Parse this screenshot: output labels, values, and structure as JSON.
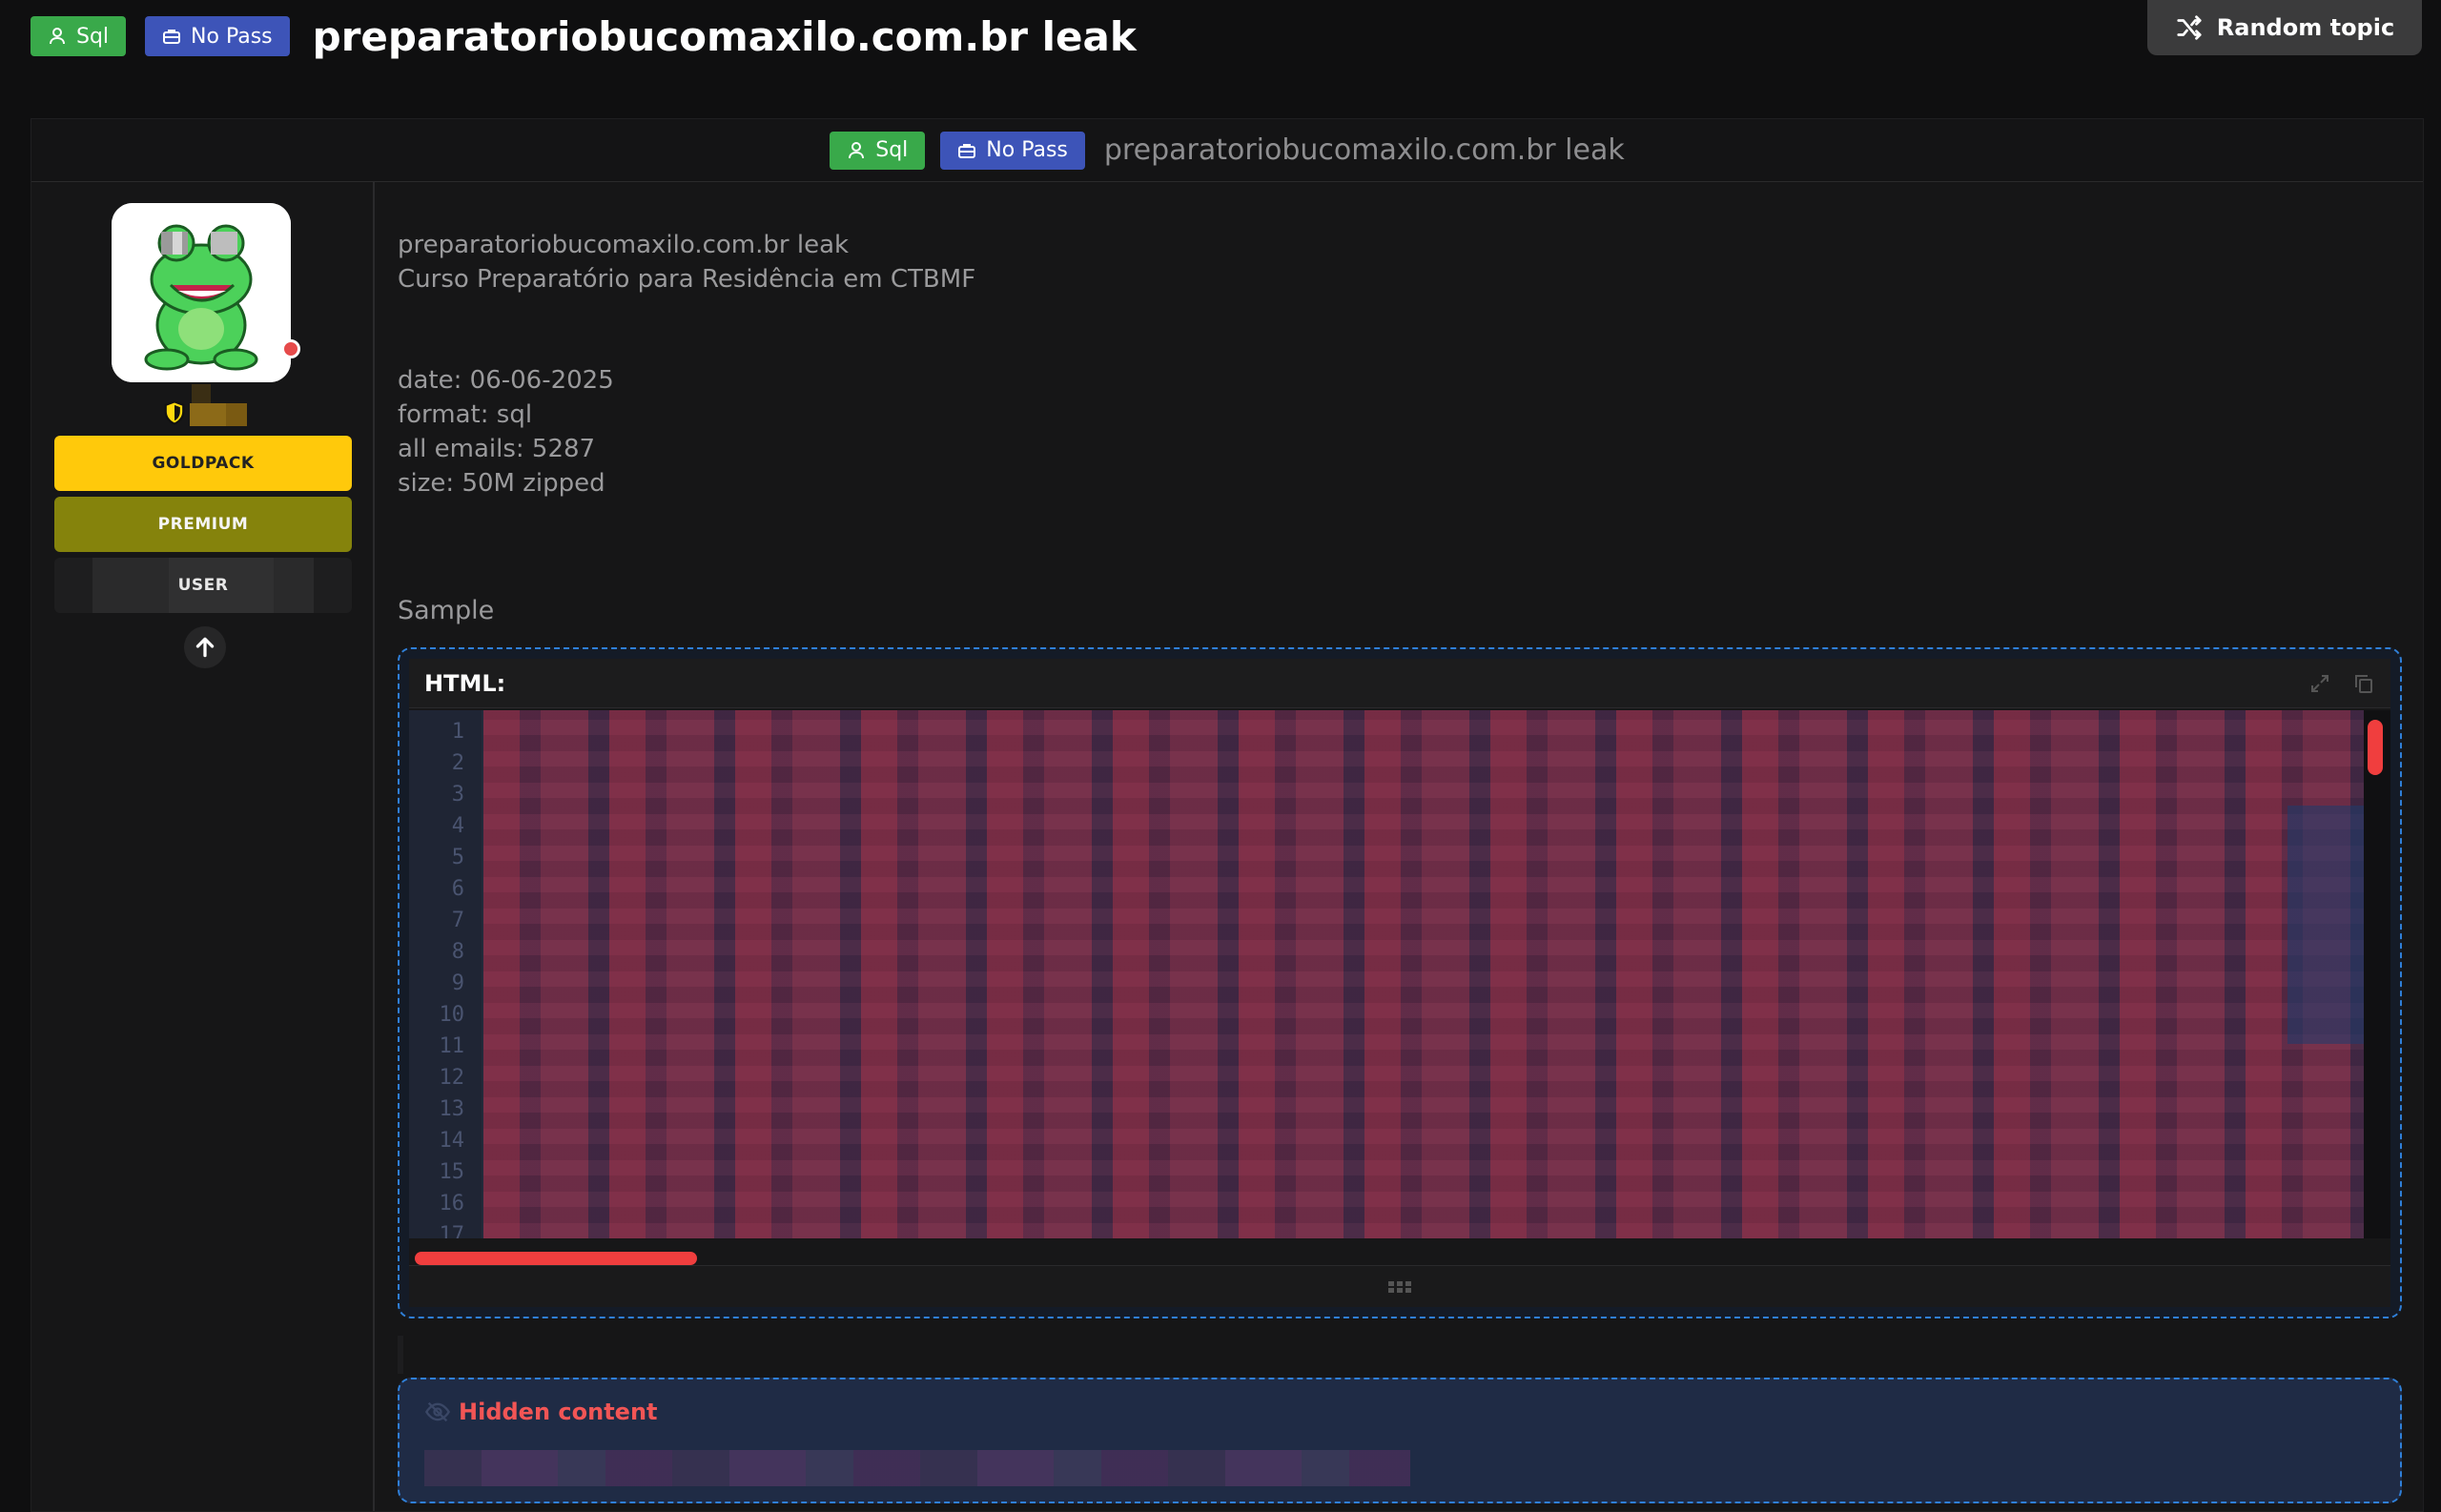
{
  "header": {
    "badge_sql": "Sql",
    "badge_nopass": "No Pass",
    "title": "preparatoriobucomaxilo.com.br leak",
    "random_button": "Random topic"
  },
  "thread": {
    "badge_sql": "Sql",
    "badge_nopass": "No Pass",
    "title": "preparatoriobucomaxilo.com.br leak"
  },
  "author": {
    "roles": [
      "GOLDPACK",
      "PREMIUM",
      "USER"
    ],
    "colors": {
      "goldpack": "#ffc90b",
      "premium": "#85830c",
      "online": "#e64b4b"
    }
  },
  "post": {
    "intro": [
      "preparatoriobucomaxilo.com.br leak",
      "Curso Preparatório para Residência em CTBMF"
    ],
    "details": [
      "date: 06-06-2025",
      "format: sql",
      "all emails: 5287",
      "size: 50M zipped"
    ],
    "sample_label": "Sample",
    "code": {
      "language": "HTML:",
      "line_numbers": [
        "1",
        "2",
        "3",
        "4",
        "5",
        "6",
        "7",
        "8",
        "9",
        "10",
        "11",
        "12",
        "13",
        "14",
        "15",
        "16",
        "17"
      ]
    },
    "hidden": {
      "title": "Hidden content"
    }
  },
  "icons": {
    "badge_sql": "user-icon",
    "badge_nopass": "briefcase-icon",
    "random": "shuffle-icon",
    "scroll_top": "arrow-up-icon",
    "expand": "expand-icon",
    "copy": "copy-icon",
    "hidden": "eye-slash-icon"
  }
}
